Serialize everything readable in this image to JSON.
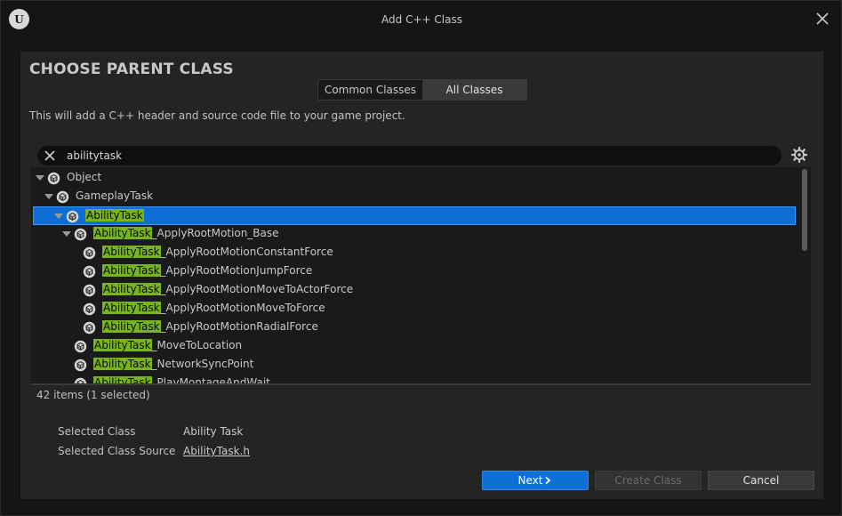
{
  "window": {
    "title": "Add C++ Class",
    "logo_text": "U"
  },
  "header": {
    "heading": "CHOOSE PARENT CLASS",
    "description": "This will add a C++ header and source code file to your game project."
  },
  "tabs": [
    {
      "label": "Common Classes",
      "active": false
    },
    {
      "label": "All Classes",
      "active": true
    }
  ],
  "search": {
    "value": "abilitytask"
  },
  "tree": {
    "rows": [
      {
        "name": "object",
        "hl": "",
        "rest": "Object",
        "depth": 0,
        "expander": "expanded"
      },
      {
        "name": "gameplay-task",
        "hl": "",
        "rest": "GameplayTask",
        "depth": 1,
        "expander": "expanded"
      },
      {
        "name": "ability-task",
        "hl": "AbilityTask",
        "rest": "",
        "depth": 2,
        "expander": "expanded",
        "selected": true
      },
      {
        "name": "ability-task-apply-root-motion-base",
        "hl": "AbilityTask",
        "rest": "_ApplyRootMotion_Base",
        "depth": 3,
        "expander": "expanded"
      },
      {
        "name": "ability-task-apply-root-motion-constant-force",
        "hl": "AbilityTask",
        "rest": "_ApplyRootMotionConstantForce",
        "depth": 4,
        "expander": "none"
      },
      {
        "name": "ability-task-apply-root-motion-jump-force",
        "hl": "AbilityTask",
        "rest": "_ApplyRootMotionJumpForce",
        "depth": 4,
        "expander": "none"
      },
      {
        "name": "ability-task-apply-root-motion-move-to-actor-force",
        "hl": "AbilityTask",
        "rest": "_ApplyRootMotionMoveToActorForce",
        "depth": 4,
        "expander": "none"
      },
      {
        "name": "ability-task-apply-root-motion-move-to-force",
        "hl": "AbilityTask",
        "rest": "_ApplyRootMotionMoveToForce",
        "depth": 4,
        "expander": "none"
      },
      {
        "name": "ability-task-apply-root-motion-radial-force",
        "hl": "AbilityTask",
        "rest": "_ApplyRootMotionRadialForce",
        "depth": 4,
        "expander": "none"
      },
      {
        "name": "ability-task-move-to-location",
        "hl": "AbilityTask",
        "rest": "_MoveToLocation",
        "depth": 3,
        "expander": "none"
      },
      {
        "name": "ability-task-network-sync-point",
        "hl": "AbilityTask",
        "rest": "_NetworkSyncPoint",
        "depth": 3,
        "expander": "none"
      },
      {
        "name": "ability-task-play-montage-and-wait",
        "hl": "AbilityTask",
        "rest": "_PlayMontageAndWait",
        "depth": 3,
        "expander": "none"
      }
    ]
  },
  "status": {
    "count": "42 items (1 selected)"
  },
  "details": {
    "selected_class_label": "Selected Class",
    "selected_class_value": "Ability Task",
    "selected_source_label": "Selected Class Source",
    "selected_source_value": "AbilityTask.h"
  },
  "buttons": {
    "next": "Next",
    "create": "Create Class",
    "cancel": "Cancel"
  },
  "colors": {
    "selection": "#0e6fd6",
    "highlight": "#78b41e",
    "primary_button": "#0e6fd6"
  }
}
